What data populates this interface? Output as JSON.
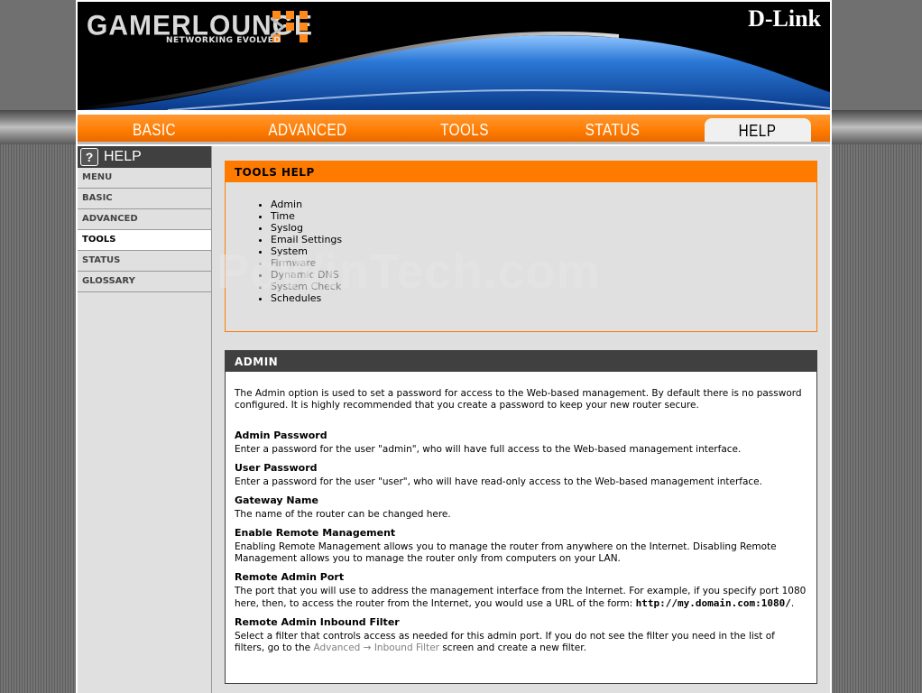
{
  "brand": {
    "product": "GAMERLOUNGE",
    "tagline": "NETWORKING EVOLVED",
    "vendor": "D-Link"
  },
  "nav": {
    "tabs": [
      "BASIC",
      "ADVANCED",
      "TOOLS",
      "STATUS",
      "HELP"
    ],
    "active": "HELP"
  },
  "sidebar": {
    "title": "HELP",
    "icon": "question-icon",
    "items": [
      "MENU",
      "BASIC",
      "ADVANCED",
      "TOOLS",
      "STATUS",
      "GLOSSARY"
    ],
    "active": "TOOLS"
  },
  "tools_help": {
    "title": "TOOLS HELP",
    "links": [
      "Admin",
      "Time",
      "Syslog",
      "Email Settings",
      "System",
      "Firmware",
      "Dynamic DNS",
      "System Check",
      "Schedules"
    ]
  },
  "admin": {
    "title": "ADMIN",
    "intro": "The Admin option is used to set a password for access to the Web-based management. By default there is no password configured. It is highly recommended that you create a password to keep your new router secure.",
    "sections": [
      {
        "heading": "Admin Password",
        "text": "Enter a password for the user \"admin\", who will have full access to the Web-based management interface."
      },
      {
        "heading": "User Password",
        "text": "Enter a password for the user \"user\", who will have read-only access to the Web-based management interface."
      },
      {
        "heading": "Gateway Name",
        "text": "The name of the router can be changed here."
      },
      {
        "heading": "Enable Remote Management",
        "text": "Enabling Remote Management allows you to manage the router from anywhere on the Internet. Disabling Remote Management allows you to manage the router only from computers on your LAN."
      },
      {
        "heading": "Remote Admin Port",
        "text": "The port that you will use to address the management interface from the Internet. For example, if you specify port 1080 here, then, to access the router from the Internet, you would use a URL of the form: "
      },
      {
        "heading": "Remote Admin Inbound Filter",
        "text": "Select a filter that controls access as needed for this admin port. If you do not see the filter you need in the list of filters, go to the "
      }
    ],
    "url_example": "http://my.domain.com:1080/",
    "url_suffix": ".",
    "filter_link_a": "Advanced",
    "filter_arrow": " → ",
    "filter_link_b": "Inbound Filter",
    "filter_suffix": " screen and create a new filter."
  },
  "watermark": "PcWinTech.com",
  "colors": {
    "accent": "#ff7b00",
    "header_dark": "#404040",
    "sidebar_bg": "#e0e0e0"
  }
}
